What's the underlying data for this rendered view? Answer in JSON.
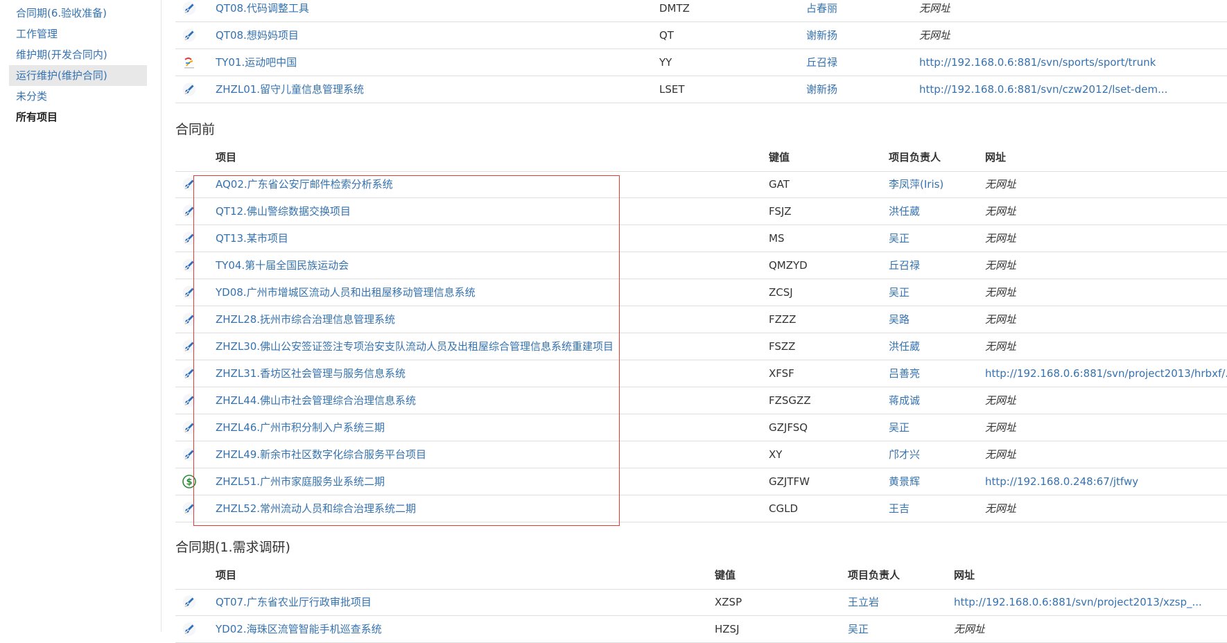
{
  "sidebar": {
    "items": [
      {
        "label": "合同期(6.验收准备)",
        "selected": false,
        "bold": false
      },
      {
        "label": "工作管理",
        "selected": false,
        "bold": false
      },
      {
        "label": "维护期(开发合同内)",
        "selected": false,
        "bold": false
      },
      {
        "label": "运行维护(维护合同)",
        "selected": true,
        "bold": false
      },
      {
        "label": "未分类",
        "selected": false,
        "bold": false
      },
      {
        "label": "所有项目",
        "selected": false,
        "bold": true
      }
    ]
  },
  "top_table": {
    "rows": [
      {
        "icon": "rocket-icon",
        "project": "QT08.代码调整工具",
        "key": "DMTZ",
        "lead": "占春丽",
        "url": "无网址",
        "has_url": false
      },
      {
        "icon": "rocket-icon",
        "project": "QT08.想妈妈项目",
        "key": "QT",
        "lead": "谢新扬",
        "url": "无网址",
        "has_url": false
      },
      {
        "icon": "sports-logo-icon",
        "project": "TY01.运动吧中国",
        "key": "YY",
        "lead": "丘召禄",
        "url": "http://192.168.0.6:881/svn/sports/sport/trunk",
        "has_url": true
      },
      {
        "icon": "rocket-icon",
        "project": "ZHZL01.留守儿童信息管理系统",
        "key": "LSET",
        "lead": "谢新扬",
        "url": "http://192.168.0.6:881/svn/czw2012/lset-dem...",
        "has_url": true
      }
    ]
  },
  "section_before": {
    "title": "合同前",
    "headers": {
      "project": "项目",
      "key": "键值",
      "lead": "项目负责人",
      "url": "网址"
    },
    "rows": [
      {
        "icon": "rocket-icon",
        "project": "AQ02.广东省公安厅邮件检索分析系统",
        "key": "GAT",
        "lead": "李凤萍(Iris)",
        "url": "无网址",
        "has_url": false
      },
      {
        "icon": "rocket-icon",
        "project": "QT12.佛山警综数据交换项目",
        "key": "FSJZ",
        "lead": "洪任葳",
        "url": "无网址",
        "has_url": false
      },
      {
        "icon": "rocket-icon",
        "project": "QT13.某市项目",
        "key": "MS",
        "lead": "吴正",
        "url": "无网址",
        "has_url": false
      },
      {
        "icon": "rocket-icon",
        "project": "TY04.第十届全国民族运动会",
        "key": "QMZYD",
        "lead": "丘召禄",
        "url": "无网址",
        "has_url": false
      },
      {
        "icon": "rocket-icon",
        "project": "YD08.广州市增城区流动人员和出租屋移动管理信息系统",
        "key": "ZCSJ",
        "lead": "吴正",
        "url": "无网址",
        "has_url": false
      },
      {
        "icon": "rocket-icon",
        "project": "ZHZL28.抚州市综合治理信息管理系统",
        "key": "FZZZ",
        "lead": "吴路",
        "url": "无网址",
        "has_url": false
      },
      {
        "icon": "rocket-icon",
        "project": "ZHZL30.佛山公安签证签注专项治安支队流动人员及出租屋综合管理信息系统重建项目",
        "key": "FSZZ",
        "lead": "洪任葳",
        "url": "无网址",
        "has_url": false
      },
      {
        "icon": "rocket-icon",
        "project": "ZHZL31.香坊区社会管理与服务信息系统",
        "key": "XFSF",
        "lead": "吕善亮",
        "url": "http://192.168.0.6:881/svn/project2013/hrbxf/...",
        "has_url": true
      },
      {
        "icon": "rocket-icon",
        "project": "ZHZL44.佛山市社会管理综合治理信息系统",
        "key": "FZSGZZ",
        "lead": "蒋成诚",
        "url": "无网址",
        "has_url": false
      },
      {
        "icon": "rocket-icon",
        "project": "ZHZL46.广州市积分制入户系统三期",
        "key": "GZJFSQ",
        "lead": "吴正",
        "url": "无网址",
        "has_url": false
      },
      {
        "icon": "rocket-icon",
        "project": "ZHZL49.新余市社区数字化综合服务平台项目",
        "key": "XY",
        "lead": "邝才兴",
        "url": "无网址",
        "has_url": false
      },
      {
        "icon": "dollar-icon",
        "project": "ZHZL51.广州市家庭服务业系统二期",
        "key": "GZJTFW",
        "lead": "黄景辉",
        "url": "http://192.168.0.248:67/jtfwy",
        "has_url": true
      },
      {
        "icon": "rocket-icon",
        "project": "ZHZL52.常州流动人员和综合治理系统二期",
        "key": "CGLD",
        "lead": "王吉",
        "url": "无网址",
        "has_url": false
      }
    ]
  },
  "section_research": {
    "title": "合同期(1.需求调研)",
    "headers": {
      "project": "项目",
      "key": "键值",
      "lead": "项目负责人",
      "url": "网址"
    },
    "rows": [
      {
        "icon": "rocket-icon",
        "project": "QT07.广东省农业厅行政审批项目",
        "key": "XZSP",
        "lead": "王立岩",
        "url": "http://192.168.0.6:881/svn/project2013/xzsp_...",
        "has_url": true
      },
      {
        "icon": "rocket-icon",
        "project": "YD02.海珠区流管智能手机巡查系统",
        "key": "HZSJ",
        "lead": "吴正",
        "url": "无网址",
        "has_url": false
      }
    ]
  },
  "colors": {
    "link": "#3572b0",
    "highlight_border": "#e53935",
    "selected_bg": "#e8e8e8"
  }
}
